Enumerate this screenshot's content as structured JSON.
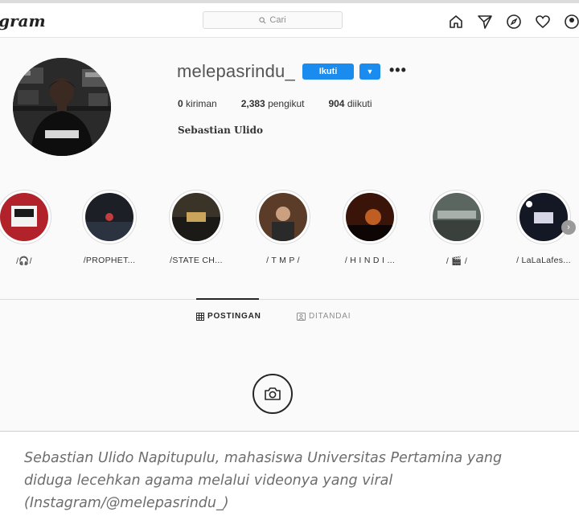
{
  "navbar": {
    "logo": "gram",
    "search_placeholder": "Cari",
    "icons": [
      "home-icon",
      "direct-icon",
      "explore-icon",
      "activity-icon",
      "profile-icon"
    ]
  },
  "profile": {
    "username": "melepasrindu_",
    "follow_label": "Ikuti",
    "stats": [
      {
        "value": "0",
        "label": "kiriman"
      },
      {
        "value": "2,383",
        "label": "pengikut"
      },
      {
        "value": "904",
        "label": "diikuti"
      }
    ],
    "full_name": "Sebastian Ulido"
  },
  "highlights": [
    {
      "label": "/🎧/",
      "tone": "#b2222a"
    },
    {
      "label": "/PROPHET...",
      "tone": "#1c2026"
    },
    {
      "label": "/STATE CH...",
      "tone": "#3a3328"
    },
    {
      "label": "/ T M P /",
      "tone": "#5b3c28"
    },
    {
      "label": "/ H I N D I ...",
      "tone": "#3a1408"
    },
    {
      "label": "/ 🎬 /",
      "tone": "#5c6660"
    },
    {
      "label": "/ LaLaLafes...",
      "tone": "#141824"
    }
  ],
  "tabs": {
    "posts": "POSTINGAN",
    "tagged": "DITANDAI"
  },
  "caption": {
    "line1": "Sebastian Ulido Napitupulu, mahasiswa Universitas Pertamina yang",
    "line2": "diduga lecehkan agama melalui videonya yang viral",
    "line3": "(Instagram/@melepasrindu_)"
  },
  "colors": {
    "accent": "#1a8cf0",
    "text": "#262626",
    "muted": "#8e8e8e",
    "caption": "#6d6d6d"
  }
}
